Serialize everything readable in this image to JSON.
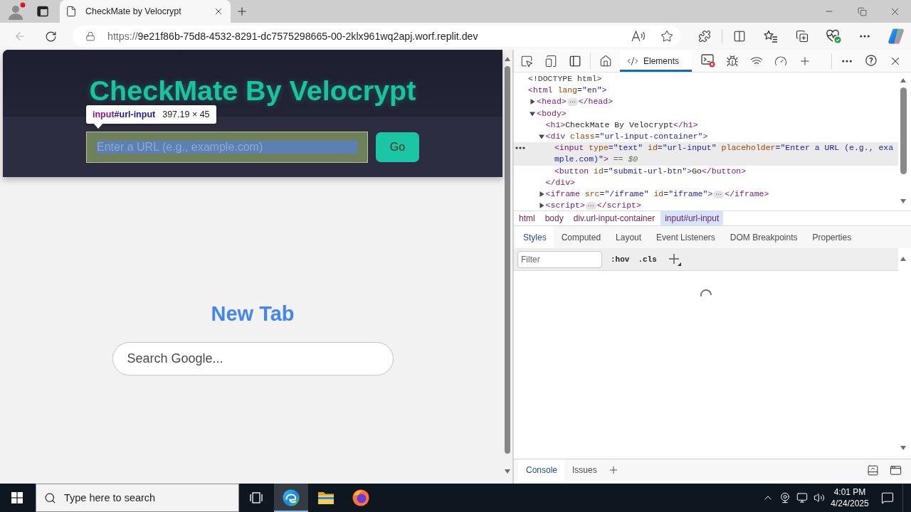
{
  "browser": {
    "tabs": [
      {
        "title": "CheckMate by Velocrypt",
        "selected": true
      }
    ],
    "back_button": {
      "disabled": true
    },
    "address": {
      "scheme": "https://",
      "host": "9e21f86b-75d8-4532-8291-dc7575298665-00-2klx961wq2apj.worf.replit.dev"
    }
  },
  "page": {
    "header": {
      "title": "CheckMate By Velocrypt",
      "url_input": {
        "placeholder": "Enter a URL (e.g., example.com)",
        "inspected": true
      },
      "submit_button": "Go"
    },
    "inspect_tooltip": {
      "tag": "input",
      "id": "#url-input",
      "size": "397.19 × 45"
    },
    "frame": {
      "heading": "New Tab",
      "search": {
        "placeholder": "Search Google..."
      }
    }
  },
  "devtools": {
    "tabs": [
      {
        "label": "Elements",
        "selected": true
      }
    ],
    "dom_tree": [
      {
        "selected": false,
        "tokens": [
          {
            "kind": "doctype",
            "text": "<!DOCTYPE html>"
          }
        ]
      },
      {
        "selected": false,
        "tokens": [
          {
            "kind": "tag",
            "text": "<html"
          },
          {
            "kind": "attr",
            "text": " lang"
          },
          {
            "kind": "value",
            "text": "=\"en\""
          },
          {
            "kind": "tag",
            "text": ">"
          }
        ],
        "children": [
          {
            "selected": false,
            "expanded": false,
            "tokens": [
              {
                "kind": "tag",
                "text": "<head>"
              },
              {
                "kind": "ellipsis",
                "text": "⋯"
              },
              {
                "kind": "tag",
                "text": "</head>"
              }
            ]
          },
          {
            "selected": false,
            "expanded": true,
            "tokens": [
              {
                "kind": "tag",
                "text": "<body>"
              }
            ],
            "children": [
              {
                "selected": false,
                "tokens": [
                  {
                    "kind": "tag",
                    "text": "<h1>"
                  },
                  {
                    "kind": "text",
                    "text": "CheckMate By Velocrypt"
                  },
                  {
                    "kind": "tag",
                    "text": "</h1>"
                  }
                ]
              },
              {
                "selected": false,
                "expanded": true,
                "tokens": [
                  {
                    "kind": "tag",
                    "text": "<div"
                  },
                  {
                    "kind": "attr",
                    "text": " class"
                  },
                  {
                    "kind": "value",
                    "text": "=\"url-input-container\""
                  },
                  {
                    "kind": "tag",
                    "text": ">"
                  }
                ],
                "children": [
                  {
                    "selected": true,
                    "tokens": [
                      {
                        "kind": "tag",
                        "text": "<input"
                      },
                      {
                        "kind": "attr",
                        "text": " type"
                      },
                      {
                        "kind": "value",
                        "text": "=\"text\""
                      },
                      {
                        "kind": "attr",
                        "text": " id"
                      },
                      {
                        "kind": "value",
                        "text": "=\"url-input\""
                      },
                      {
                        "kind": "attr",
                        "text": " placeholder"
                      },
                      {
                        "kind": "value",
                        "text": "=\"Enter a URL (e.g., example.com)\""
                      },
                      {
                        "kind": "tag",
                        "text": ">"
                      },
                      {
                        "kind": "note",
                        "text": " == $0"
                      }
                    ]
                  },
                  {
                    "selected": false,
                    "tokens": [
                      {
                        "kind": "tag",
                        "text": "<button"
                      },
                      {
                        "kind": "attr",
                        "text": " id"
                      },
                      {
                        "kind": "value",
                        "text": "=\"submit-url-btn\""
                      },
                      {
                        "kind": "tag",
                        "text": ">"
                      },
                      {
                        "kind": "text",
                        "text": "Go"
                      },
                      {
                        "kind": "tag",
                        "text": "</button>"
                      }
                    ]
                  }
                ],
                "closing": [
                  {
                    "kind": "tag",
                    "text": "</div>"
                  }
                ]
              },
              {
                "selected": false,
                "expanded": false,
                "tokens": [
                  {
                    "kind": "tag",
                    "text": "<iframe"
                  },
                  {
                    "kind": "attr",
                    "text": " src"
                  },
                  {
                    "kind": "value",
                    "text": "=\"/iframe\""
                  },
                  {
                    "kind": "attr",
                    "text": " id"
                  },
                  {
                    "kind": "value",
                    "text": "=\"iframe\""
                  },
                  {
                    "kind": "tag",
                    "text": ">"
                  },
                  {
                    "kind": "ellipsis",
                    "text": "⋯"
                  },
                  {
                    "kind": "tag",
                    "text": "</iframe>"
                  }
                ]
              },
              {
                "selected": false,
                "expanded": false,
                "tokens": [
                  {
                    "kind": "tag",
                    "text": "<script>"
                  },
                  {
                    "kind": "ellipsis",
                    "text": "⋯"
                  },
                  {
                    "kind": "tag",
                    "text": "</script>"
                  }
                ]
              }
            ]
          }
        ]
      }
    ],
    "breadcrumbs": [
      {
        "label": "html",
        "selected": false
      },
      {
        "label": "body",
        "selected": false
      },
      {
        "label": "div.url-input-container",
        "selected": false
      },
      {
        "label": "input#url-input",
        "selected": true
      }
    ],
    "panel_tabs": [
      {
        "label": "Styles",
        "selected": true
      },
      {
        "label": "Computed",
        "selected": false
      },
      {
        "label": "Layout",
        "selected": false
      },
      {
        "label": "Event Listeners",
        "selected": false
      },
      {
        "label": "DOM Breakpoints",
        "selected": false
      },
      {
        "label": "Properties",
        "selected": false
      }
    ],
    "styles": {
      "filter": {
        "placeholder": "Filter"
      },
      "toggles": [
        ":hov",
        ".cls"
      ],
      "loading": true
    },
    "drawer_tabs": [
      {
        "label": "Console",
        "selected": true
      },
      {
        "label": "Issues",
        "selected": false
      }
    ]
  },
  "taskbar": {
    "search": {
      "placeholder": "Type here to search"
    },
    "apps": [
      {
        "kind": "edge",
        "active": true
      },
      {
        "kind": "explorer",
        "active": false
      },
      {
        "kind": "firefox",
        "active": false
      }
    ],
    "clock": {
      "time": "4:01 PM",
      "date": "4/24/2025"
    }
  }
}
